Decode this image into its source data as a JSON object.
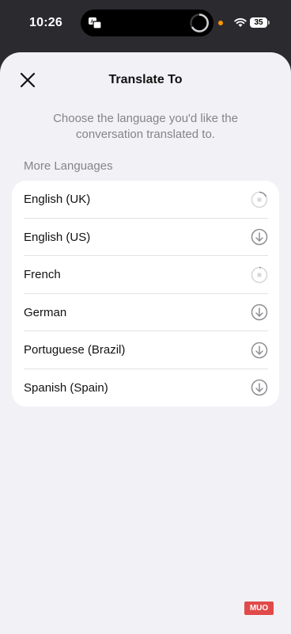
{
  "status_bar": {
    "time": "10:26",
    "battery": "35",
    "icons": [
      "translate-icon",
      "activity-ring-icon",
      "mic-indicator-dot",
      "wifi-icon",
      "battery-icon"
    ]
  },
  "sheet": {
    "title": "Translate To",
    "close_icon": "close-icon",
    "subtitle": "Choose the language you'd like the conversation translated to.",
    "section_header": "More Languages",
    "languages": [
      {
        "label": "English (UK)",
        "status_icon": "downloading-progress-icon"
      },
      {
        "label": "English (US)",
        "status_icon": "download-icon"
      },
      {
        "label": "French",
        "status_icon": "downloading-stop-icon"
      },
      {
        "label": "German",
        "status_icon": "download-icon"
      },
      {
        "label": "Portuguese (Brazil)",
        "status_icon": "download-icon"
      },
      {
        "label": "Spanish (Spain)",
        "status_icon": "download-icon"
      }
    ]
  },
  "watermark": "MUO",
  "colors": {
    "background": "#2b2a2f",
    "sheet": "#f2f1f6",
    "secondary_text": "#85848a",
    "icon_gray": "#8e8e93",
    "indicator_orange": "#ff9500",
    "watermark_red": "#e04a4a"
  }
}
